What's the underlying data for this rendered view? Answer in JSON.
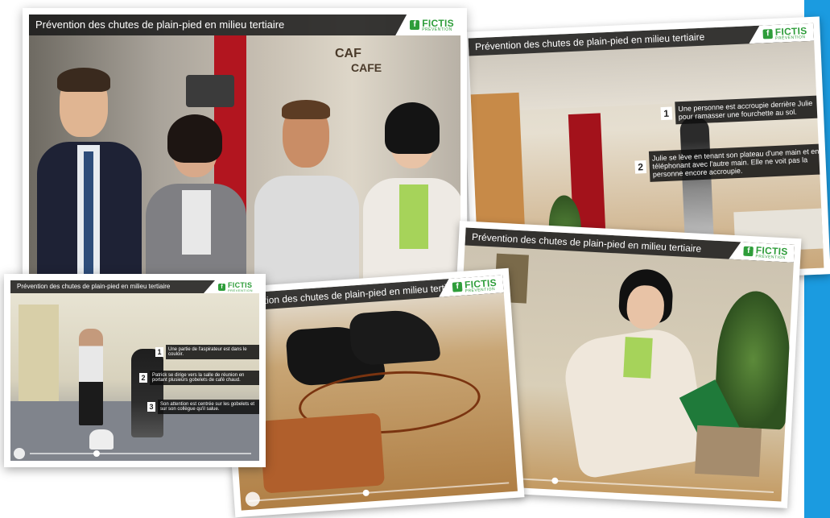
{
  "slides": {
    "s1": {
      "title": "Prévention des chutes de plain-pied en milieu tertiaire"
    },
    "s2": {
      "title": "Prévention des chutes de plain-pied en milieu tertiaire",
      "callouts": [
        {
          "num": "1",
          "text": "Une personne est accroupie derrière Julie pour ramasser une fourchette au sol."
        },
        {
          "num": "2",
          "text": "Julie se lève en tenant son plateau d'une main et en téléphonant avec l'autre main. Elle ne voit pas la personne encore accroupie."
        }
      ]
    },
    "s3": {
      "title": "Prévention des chutes de plain-pied en milieu tertiaire",
      "callouts": [
        {
          "num": "1",
          "text": "Une partie de l'aspirateur est dans le couloir."
        },
        {
          "num": "2",
          "text": "Patrick se dirige vers la salle de réunion en portant plusieurs gobelets de café chaud."
        },
        {
          "num": "3",
          "text": "Son attention est centrée sur les gobelets et sur son collègue qu'il salue."
        }
      ]
    },
    "s4": {
      "title": "Prévention des chutes de plain-pied en milieu tertiaire"
    },
    "s5": {
      "title": "Prévention des chutes de plain-pied en milieu tertiaire"
    }
  },
  "scene_text": {
    "cafe1": "CAF",
    "cafe2": "CAFE"
  },
  "logo": {
    "name": "FICTIS",
    "sub": "PRÉVENTION",
    "mark": "f"
  },
  "progress": {
    "s3": 0.3,
    "s4": 0.45,
    "s5": 0.3
  },
  "colors": {
    "accent_blue": "#1b9be0",
    "logo_green": "#2e9d3a",
    "titlebar": "#191919"
  }
}
